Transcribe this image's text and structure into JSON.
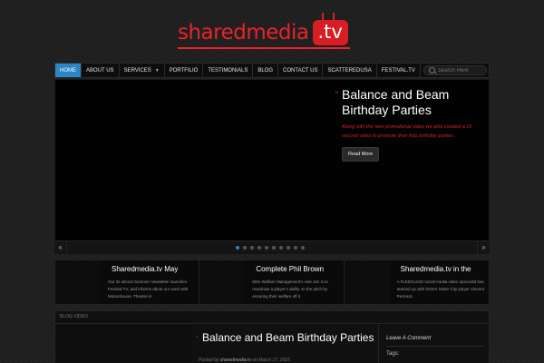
{
  "logo": {
    "name": "sharedmedia",
    "suffix": ".tv"
  },
  "nav": {
    "items": [
      "HOME",
      "ABOUT US",
      "SERVICES",
      "PORTFILIO",
      "TESTIMONIALS",
      "BLOG",
      "CONTACT US",
      "SCATTEREDUSA",
      "FESTIVAL.TV"
    ],
    "active_index": 0,
    "search_placeholder": "Search Here"
  },
  "slider": {
    "title": "Balance and Beam Birthday Parties",
    "description": "Along with the new promotional video we also created a 10 second video to promote their kids birthday parties.",
    "button_label": "Read More",
    "prev_symbol": "«",
    "next_symbol": "»",
    "slide_count": 10,
    "active_slide": 0
  },
  "features": [
    {
      "title": "Sharedmedia.tv May",
      "excerpt": "Our its almost Summer newsletter launches Festival TV, and informs about our work with Motionhouse. Theatre in"
    },
    {
      "title": "Complete Phil Brown",
      "excerpt": "Elite Welfare Management's sole aim is to maximise a player's ability on the pitch by ensuring their welfare off it"
    },
    {
      "title": "Sharedmedia.tv in the",
      "excerpt": "A FLEDGLING social media video specialist has teamed up with former Stoke City player Vincent Pericard."
    }
  ],
  "blog": {
    "header": "BLOG VIDEO",
    "title": "Balance and Beam Birthday Parties",
    "meta_prefix": "Posted by",
    "author": "sharedmedia.tv",
    "meta_on": "on",
    "date": "March 17, 2015"
  },
  "sidebar": {
    "comment_label": "Leave A Comment",
    "tags_label": "Tags:"
  },
  "colors": {
    "accent": "#e8232a",
    "nav_active": "#2b86c5"
  }
}
